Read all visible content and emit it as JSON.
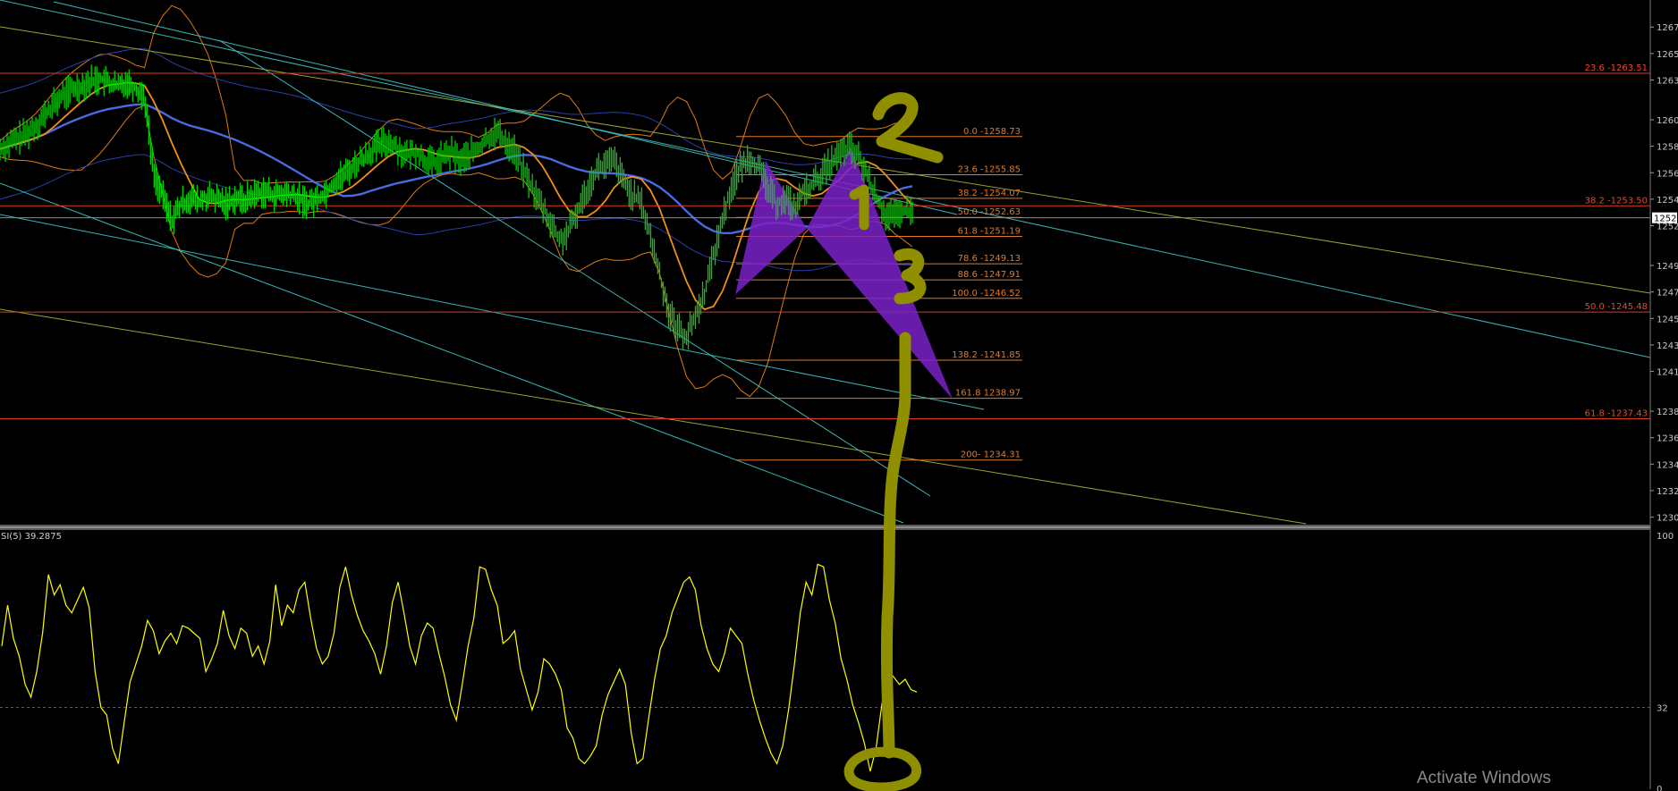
{
  "chart_data": [
    {
      "type": "line",
      "panel": "price",
      "y_axis": {
        "ylim": [
          1229.5,
          1268.5
        ],
        "ticks": [
          1267,
          1265,
          1263,
          1260,
          1258,
          1256,
          1254,
          1252,
          1249,
          1247,
          1245,
          1243,
          1241,
          1238,
          1236,
          1234,
          1232,
          1230
        ]
      },
      "current_price_label": "1252",
      "close_series": [
        1257.8,
        1258.2,
        1258.6,
        1259.0,
        1259.6,
        1260.4,
        1261.2,
        1261.9,
        1262.3,
        1262.6,
        1262.9,
        1263.1,
        1262.8,
        1262.5,
        1262.9,
        1262.4,
        1261.8,
        1256.0,
        1254.2,
        1252.4,
        1253.6,
        1254.1,
        1253.8,
        1254.2,
        1254.0,
        1253.7,
        1254.1,
        1253.9,
        1254.3,
        1254.6,
        1254.4,
        1254.3,
        1254.4,
        1254.1,
        1253.7,
        1254.0,
        1254.5,
        1255.3,
        1255.8,
        1256.4,
        1257.0,
        1257.6,
        1258.1,
        1258.4,
        1257.9,
        1257.3,
        1257.6,
        1257.0,
        1256.7,
        1257.2,
        1257.5,
        1256.9,
        1257.4,
        1257.8,
        1258.6,
        1259.1,
        1258.3,
        1257.6,
        1256.1,
        1254.7,
        1253.5,
        1252.2,
        1250.8,
        1251.6,
        1253.2,
        1254.8,
        1256.2,
        1256.6,
        1256.9,
        1255.4,
        1254.3,
        1253.7,
        1251.2,
        1248.4,
        1245.6,
        1244.3,
        1243.6,
        1245.2,
        1247.0,
        1249.8,
        1252.6,
        1255.0,
        1256.4,
        1257.2,
        1256.3,
        1254.8,
        1253.6,
        1254.1,
        1253.3,
        1254.6,
        1255.1,
        1255.9,
        1256.8,
        1257.4,
        1257.9,
        1257.2,
        1255.8,
        1254.1,
        1252.9,
        1252.6,
        1253.1,
        1253.0
      ],
      "fib_retracement_short": [
        {
          "label": "0.0 -1258.73",
          "value": 1258.73
        },
        {
          "label": "23.6 -1255.85",
          "value": 1255.85
        },
        {
          "label": "38.2 -1254.07",
          "value": 1254.07
        },
        {
          "label": "50.0 -1252.63",
          "value": 1252.63
        },
        {
          "label": "61.8 -1251.19",
          "value": 1251.19
        },
        {
          "label": "78.6 -1249.13",
          "value": 1249.13
        },
        {
          "label": "88.6 -1247.91",
          "value": 1247.91
        },
        {
          "label": "100.0 -1246.52",
          "value": 1246.52
        },
        {
          "label": "138.2  -1241.85",
          "value": 1241.85
        },
        {
          "label": "161.8 1238.97",
          "value": 1238.97
        },
        {
          "label": "200- 1234.31",
          "value": 1234.31
        }
      ],
      "fib_retracement_long": [
        {
          "label": "23.6 -1263.51",
          "value": 1263.51
        },
        {
          "label": "38.2 -1253.50",
          "value": 1253.5
        },
        {
          "label": "50.0 -1245.48",
          "value": 1245.48
        },
        {
          "label": "61.8 -1237.43",
          "value": 1237.43
        }
      ],
      "annotations": [
        {
          "text": "2",
          "color": "#8f8f00"
        },
        {
          "text": "1",
          "color": "#8f8f00"
        },
        {
          "text": "3",
          "color": "#8f8f00"
        }
      ],
      "colors": {
        "candles": "#00d000",
        "fib_short": "#e07a28",
        "fib_long": "#e03a22",
        "trend_cyan": "#3fc8c8",
        "trend_olive": "#a6b43a",
        "ma_blue": "#4a6ae0",
        "ma_orange": "#f0901a",
        "bollinger": "#e07a10",
        "pattern_fill": "#7a22c8",
        "marker": "#8f8f00"
      }
    },
    {
      "type": "line",
      "panel": "rsi",
      "title": "SI(5) 39.2875",
      "ylim": [
        0,
        100
      ],
      "ticks": [
        100,
        32,
        0
      ],
      "level": 32,
      "values": [
        56,
        72,
        59,
        52,
        41,
        36,
        46,
        61,
        84,
        76,
        80,
        72,
        69,
        74,
        79,
        71,
        46,
        32,
        29,
        16,
        10,
        26,
        42,
        49,
        56,
        66,
        62,
        53,
        58,
        61,
        57,
        64,
        63,
        61,
        59,
        46,
        51,
        57,
        70,
        60,
        55,
        63,
        61,
        52,
        56,
        49,
        58,
        80,
        64,
        72,
        69,
        78,
        81,
        67,
        55,
        49,
        52,
        61,
        79,
        87,
        76,
        68,
        62,
        58,
        53,
        45,
        56,
        73,
        81,
        69,
        56,
        49,
        60,
        65,
        63,
        53,
        44,
        33,
        27,
        41,
        56,
        67,
        87,
        86,
        78,
        72,
        57,
        59,
        62,
        47,
        39,
        31,
        38,
        51,
        49,
        45,
        39,
        24,
        20,
        12,
        10,
        13,
        17,
        29,
        37,
        42,
        47,
        41,
        22,
        10,
        12,
        28,
        43,
        55,
        60,
        69,
        75,
        81,
        83,
        78,
        64,
        55,
        49,
        46,
        53,
        63,
        60,
        57,
        45,
        35,
        27,
        20,
        14,
        10,
        17,
        31,
        49,
        69,
        81,
        76,
        88,
        87,
        74,
        65,
        51,
        43,
        33,
        26,
        18,
        7,
        16,
        33,
        47,
        44,
        41,
        43,
        39,
        38
      ]
    }
  ],
  "footer": {
    "watermark": "Activate Windows"
  }
}
